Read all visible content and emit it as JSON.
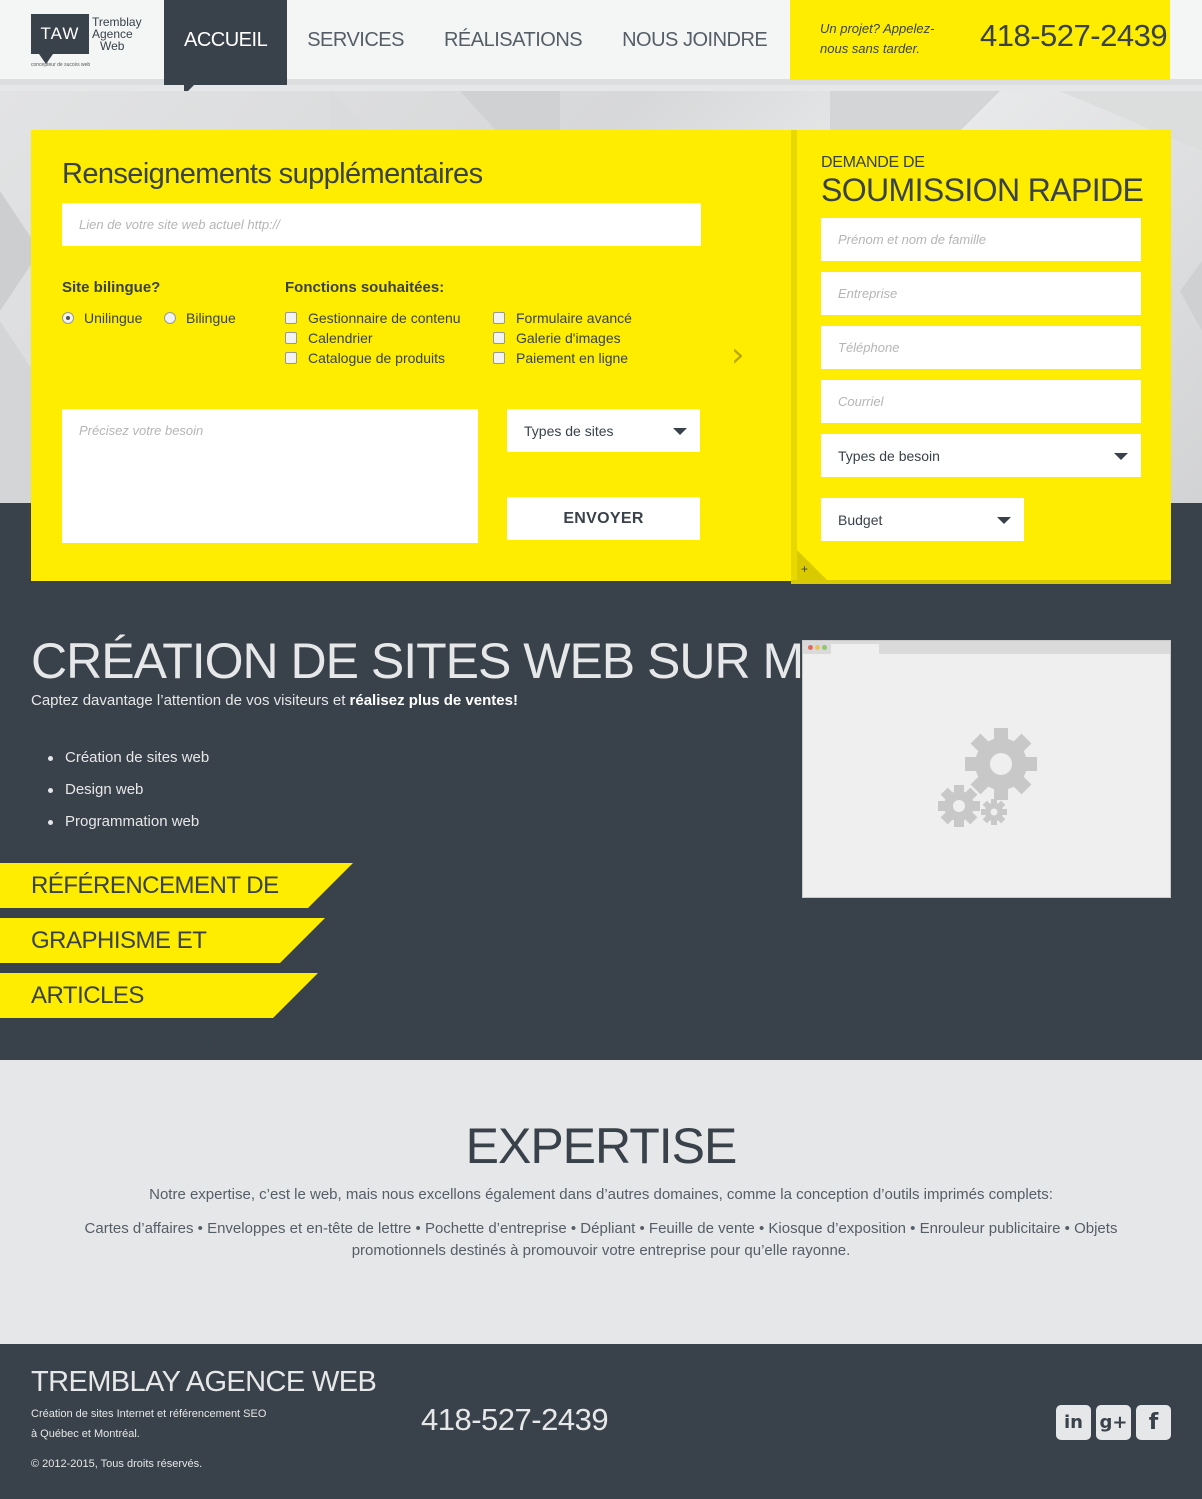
{
  "header": {
    "logo": {
      "letters": "TAW",
      "line1": "Tremblay",
      "line2": "Agence",
      "line3": "Web",
      "tagline": "concepteur de succès web"
    },
    "nav": [
      {
        "label": "ACCUEIL",
        "active": true
      },
      {
        "label": "SERVICES",
        "active": false
      },
      {
        "label": "RÉALISATIONS",
        "active": false
      },
      {
        "label": "NOUS JOINDRE",
        "active": false
      }
    ],
    "call_text": "Un projet? Appelez-nous sans tarder.",
    "phone": "418-527-2439"
  },
  "form_left": {
    "title": "Renseignements supplémentaires",
    "url_placeholder": "Lien de votre site web actuel http://",
    "bilingual_label": "Site bilingue?",
    "radio_options": [
      {
        "label": "Unilingue",
        "checked": true
      },
      {
        "label": "Bilingue",
        "checked": false
      }
    ],
    "functions_label": "Fonctions souhaitées:",
    "checkboxes_col1": [
      "Gestionnaire de contenu",
      "Calendrier",
      "Catalogue de produits"
    ],
    "checkboxes_col2": [
      "Formulaire avancé",
      "Galerie d'images",
      "Paiement en ligne"
    ],
    "textarea_placeholder": "Précisez votre besoin",
    "select_types": "Types de sites",
    "send_label": "ENVOYER",
    "next_icon": "chevron-right-icon"
  },
  "form_right": {
    "small_title": "DEMANDE DE",
    "big_title": "SOUMISSION RAPIDE",
    "fields": [
      "Prénom et nom de famille",
      "Entreprise",
      "Téléphone",
      "Courriel"
    ],
    "select_need": "Types de besoin",
    "select_budget": "Budget",
    "corner_plus": "+"
  },
  "main": {
    "title": "CRÉATION DE SITES WEB SUR MESURE",
    "subtitle_plain": "Captez davantage l’attention de vos visiteurs et ",
    "subtitle_bold": "réalisez plus de ventes!",
    "bullets": [
      "Création de sites web",
      "Design web",
      "Programmation web"
    ],
    "ribbons": [
      "RÉFÉRENCEMENT DE SITES WEB",
      "GRAPHISME ET IMPRESSION",
      "ARTICLES PROMOTIONNELS"
    ]
  },
  "expertise": {
    "title": "EXPERTISE",
    "intro": "Notre expertise, c’est le web, mais nous excellons également dans d’autres domaines, comme la conception d’outils imprimés complets:",
    "list": "Cartes d’affaires • Enveloppes et en-tête de lettre • Pochette d’entreprise • Dépliant • Feuille de vente • Kiosque d’exposition • Enrouleur publicitaire • Objets promotionnels destinés à promouvoir votre entreprise pour qu’elle rayonne."
  },
  "footer": {
    "title": "TREMBLAY AGENCE WEB",
    "desc": "Création de sites Internet et référencement SEO à Québec et Montréal.",
    "copyright": "© 2012-2015, Tous droits réservés.",
    "phone": "418-527-2439",
    "social": [
      {
        "icon": "linkedin-icon",
        "glyph": "in"
      },
      {
        "icon": "google-plus-icon",
        "glyph": "g+"
      },
      {
        "icon": "facebook-icon",
        "glyph": "f"
      }
    ]
  },
  "colors": {
    "accent": "#ffed00",
    "dark": "#39424a",
    "light": "#e6e7e8"
  }
}
